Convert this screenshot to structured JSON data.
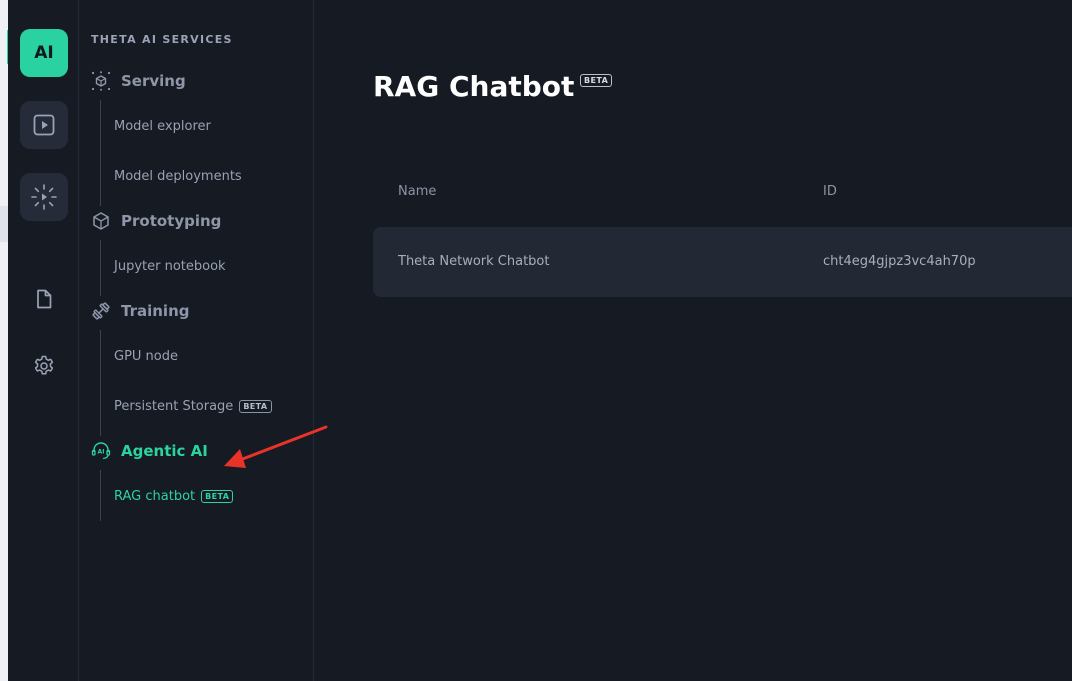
{
  "rail": {
    "ai_label": "AI",
    "icons": [
      "video-play-icon",
      "sparkle-icon",
      "document-icon",
      "gear-icon"
    ]
  },
  "sidebar": {
    "title": "THETA AI SERVICES",
    "sections": [
      {
        "label": "Serving",
        "icon": "cube-network-icon",
        "items": [
          {
            "label": "Model explorer"
          },
          {
            "label": "Model deployments"
          }
        ]
      },
      {
        "label": "Prototyping",
        "icon": "cube-icon",
        "items": [
          {
            "label": "Jupyter notebook"
          }
        ]
      },
      {
        "label": "Training",
        "icon": "dumbbell-icon",
        "items": [
          {
            "label": "GPU node"
          },
          {
            "label": "Persistent Storage",
            "badge": "BETA"
          }
        ]
      },
      {
        "label": "Agentic AI",
        "icon": "ai-headset-icon",
        "active": true,
        "items": [
          {
            "label": "RAG chatbot",
            "badge": "BETA",
            "active": true
          }
        ]
      }
    ]
  },
  "main": {
    "title": "RAG Chatbot",
    "title_badge": "BETA",
    "table": {
      "columns": [
        "Name",
        "ID"
      ],
      "rows": [
        [
          "Theta Network Chatbot",
          "cht4eg4gjpz3vc4ah70p"
        ]
      ]
    }
  },
  "colors": {
    "accent": "#2bd49f",
    "background": "#151a23",
    "row_bg": "#232835",
    "annotation_arrow": "#e8322a"
  }
}
